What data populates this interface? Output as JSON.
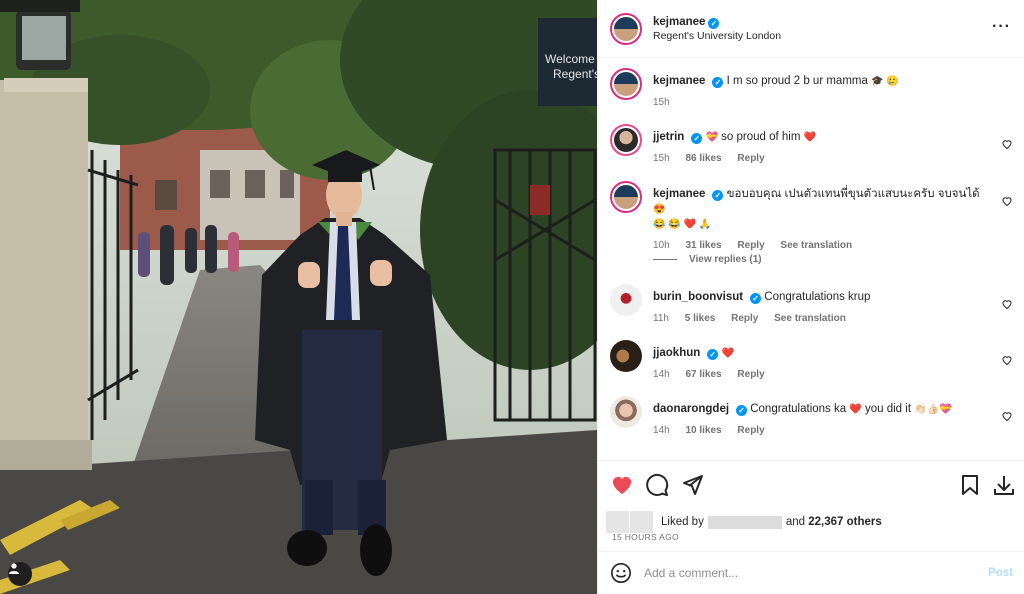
{
  "post": {
    "username": "kejmanee",
    "location": "Regent's University London",
    "more_icon": "more-options-icon",
    "sign_text": [
      "Welcome",
      "Regent's"
    ]
  },
  "caption": {
    "username": "kejmanee",
    "text": "I m so proud 2 b ur mamma",
    "emojis": "🎓 🥲",
    "time": "15h"
  },
  "comments": [
    {
      "username": "jjetrin",
      "verified": true,
      "text": "so proud of him",
      "prefix_emoji": "💝",
      "suffix_emoji": "❤️",
      "time": "15h",
      "likes": "86 likes",
      "reply": "Reply"
    },
    {
      "username": "kejmanee",
      "verified": true,
      "text": "ขอบอบคุณ เปนตัวแทนพี่ขุนตัวแสบนะครับ จบจนได้",
      "suffix_emoji": "😍",
      "second_line": "😂 😂 ❤️ 🙏",
      "time": "10h",
      "likes": "31 likes",
      "reply": "Reply",
      "translation": "See translation"
    },
    {
      "username": "burin_boonvisut",
      "verified": true,
      "text": "Congratulations krup",
      "time": "11h",
      "likes": "5 likes",
      "reply": "Reply",
      "translation": "See translation"
    },
    {
      "username": "jjaokhun",
      "verified": true,
      "text": "",
      "suffix_emoji": "❤️",
      "time": "14h",
      "likes": "67 likes",
      "reply": "Reply"
    },
    {
      "username": "daonarongdej",
      "verified": true,
      "text": "Congratulations ka",
      "suffix_emoji": "❤️",
      "text2": "you did it",
      "end_emoji": "👏🏻👍🏻💝",
      "time": "14h",
      "likes": "10 likes",
      "reply": "Reply"
    }
  ],
  "view_replies": "View replies (1)",
  "actions": {
    "like_icon": "heart-filled-icon",
    "comment_icon": "comment-icon",
    "share_icon": "share-icon",
    "save_icon": "bookmark-icon",
    "download_icon": "download-icon",
    "liked_by_prefix": "Liked by",
    "liked_by_suffix": "and",
    "others": "22,367 others",
    "timestamp": "15 HOURS AGO"
  },
  "comment_box": {
    "placeholder": "Add a comment...",
    "post_label": "Post",
    "emoji_icon": "smiley-icon"
  },
  "colors": {
    "like_red": "#ed4956",
    "verified_blue": "#0095f6",
    "post_button": "#b2dffc"
  }
}
